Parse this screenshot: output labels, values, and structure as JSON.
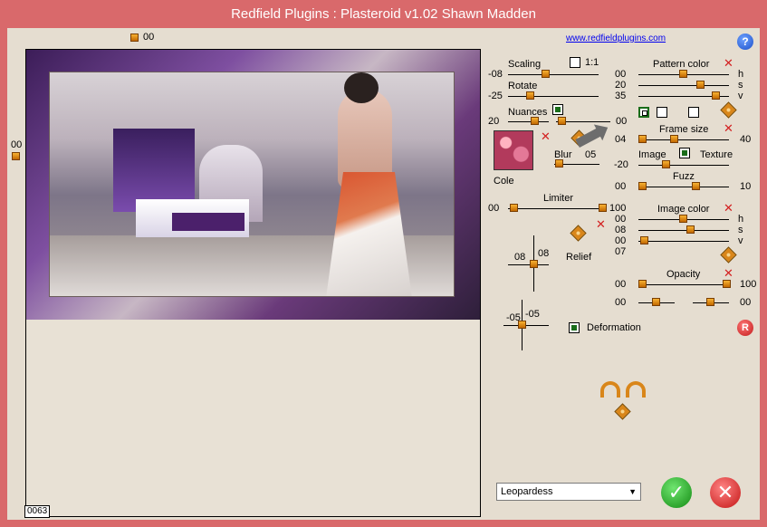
{
  "window": {
    "title": "Redfield Plugins : Plasteroid v1.02   Shawn Madden"
  },
  "top_marker": {
    "value": "00"
  },
  "left_marker": {
    "value": "00"
  },
  "website": {
    "link": "www.redfieldplugins.com"
  },
  "help": {
    "glyph": "?"
  },
  "scaling": {
    "label": "Scaling",
    "value": "-08",
    "ratio_label": "1:1",
    "position": 0.45
  },
  "rotate": {
    "label": "Rotate",
    "value": "-25",
    "position": 0.38
  },
  "nuances": {
    "label": "Nuances",
    "value_left": "20",
    "value_right": "00"
  },
  "swatch": {
    "label": "Cole"
  },
  "blur": {
    "label": "Blur",
    "value": "05"
  },
  "limiter": {
    "label": "Limiter",
    "value_left": "00",
    "value_right": "100"
  },
  "relief": {
    "label": "Relief",
    "value_x": "08",
    "value_y": "08"
  },
  "deformation": {
    "label": "Deformation",
    "value_x": "-05",
    "value_y": "-05"
  },
  "pattern_color": {
    "label": "Pattern color",
    "h": "00",
    "s": "20",
    "v": "35",
    "h_label": "h",
    "s_label": "s",
    "v_label": "v"
  },
  "frame_size": {
    "label": "Frame size",
    "value_left": "04",
    "value_right": "40"
  },
  "image_texture": {
    "label_left": "Image",
    "label_right": "Texture",
    "value": "-20"
  },
  "fuzz": {
    "label": "Fuzz",
    "value_left": "00",
    "value_right": "10"
  },
  "image_color": {
    "label": "Image color",
    "h": "00",
    "s": "08",
    "v": "00",
    "extra": "07",
    "h_label": "h",
    "s_label": "s",
    "v_label": "v"
  },
  "opacity": {
    "label": "Opacity",
    "value_left": "00",
    "value_right": "100",
    "value_bottom_left": "00",
    "value_bottom_right": "00"
  },
  "reset": {
    "glyph": "R"
  },
  "preset": {
    "selected": "Leopardess"
  },
  "ok": {
    "glyph": "✓"
  },
  "cancel": {
    "glyph": "✕"
  },
  "counter": {
    "value": "0063"
  },
  "colors": {
    "title_bar": "#d9696b",
    "client_bg": "#e5ddd0",
    "knob": "#e88a10",
    "accent_green": "#138a13",
    "accent_red": "#c31414"
  }
}
